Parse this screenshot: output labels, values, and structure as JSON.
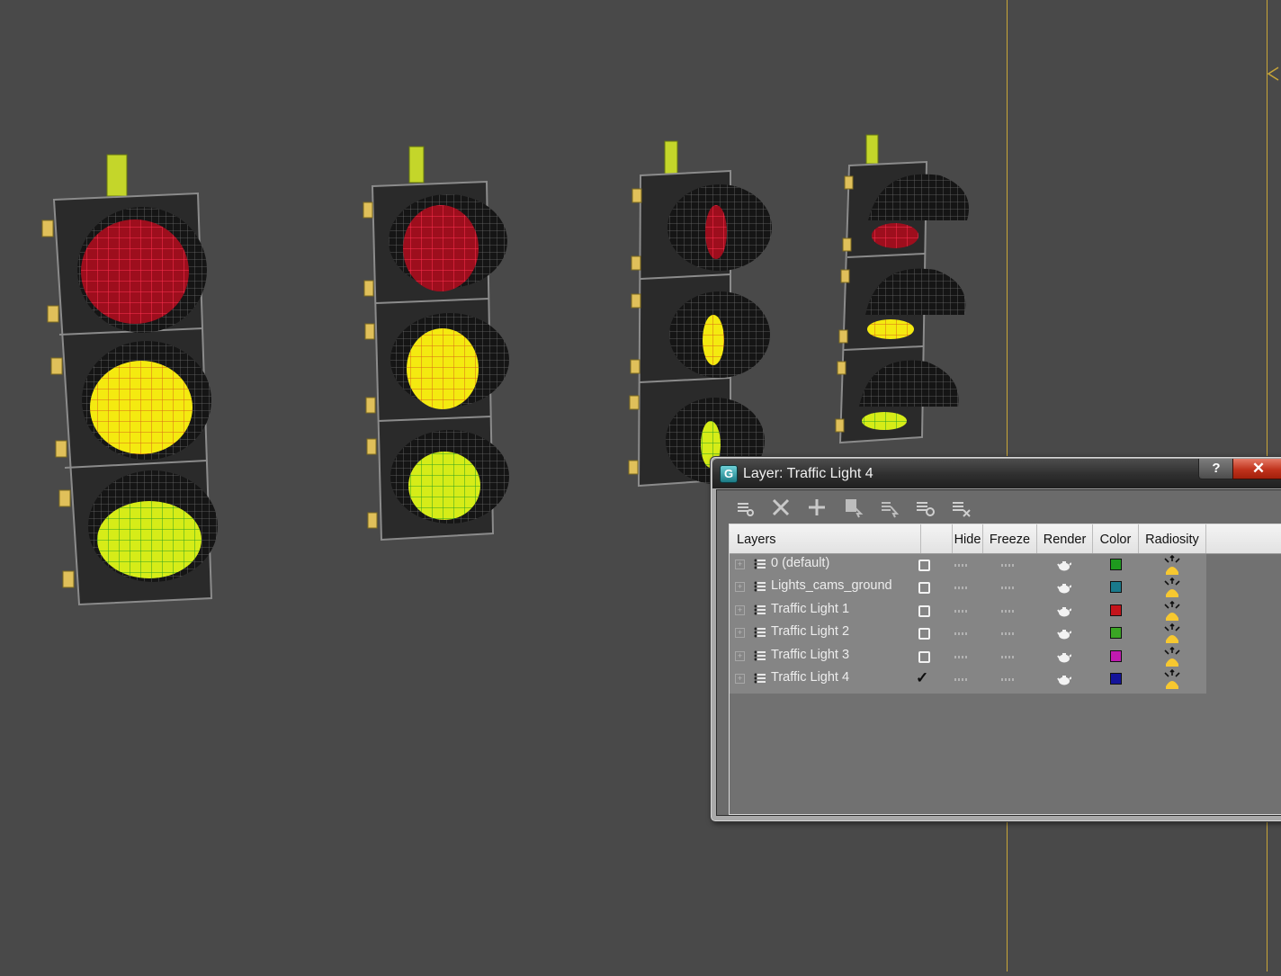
{
  "dialog": {
    "title": "Layer: Traffic Light 4",
    "app_icon_glyph": "G",
    "help_label": "?",
    "close_label": "✕"
  },
  "toolbar": {
    "buttons": [
      {
        "name": "new-layer-button",
        "icon": "new-layer-icon"
      },
      {
        "name": "delete-layer-button",
        "icon": "x-icon"
      },
      {
        "name": "add-to-layer-button",
        "icon": "plus-icon"
      },
      {
        "name": "select-objects-button",
        "icon": "select-objects-icon"
      },
      {
        "name": "highlight-selected-button",
        "icon": "highlight-icon"
      },
      {
        "name": "hide-all-button",
        "icon": "hide-all-icon"
      },
      {
        "name": "freeze-all-button",
        "icon": "freeze-all-icon"
      }
    ]
  },
  "columns": {
    "layers": "Layers",
    "hide": "Hide",
    "freeze": "Freeze",
    "render": "Render",
    "color": "Color",
    "radiosity": "Radiosity"
  },
  "layers": [
    {
      "name": "0 (default)",
      "current": false,
      "color": "#1e9a1e"
    },
    {
      "name": "Lights_cams_ground",
      "current": false,
      "color": "#1a7a8c"
    },
    {
      "name": "Traffic Light 1",
      "current": false,
      "color": "#c4141b"
    },
    {
      "name": "Traffic Light 2",
      "current": false,
      "color": "#3aa524"
    },
    {
      "name": "Traffic Light 3",
      "current": false,
      "color": "#c01ab0"
    },
    {
      "name": "Traffic Light 4",
      "current": true,
      "color": "#14149a"
    }
  ],
  "viewport": {
    "background": "#494949",
    "guide_color": "#c9a638"
  }
}
